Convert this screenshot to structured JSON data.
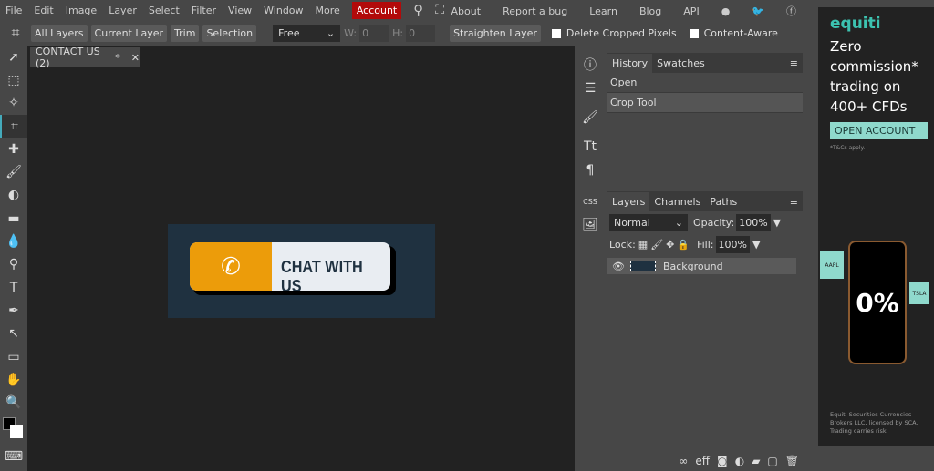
{
  "menu": {
    "items": [
      "File",
      "Edit",
      "Image",
      "Layer",
      "Select",
      "Filter",
      "View",
      "Window",
      "More"
    ],
    "account": "Account",
    "right": [
      "About",
      "Report a bug",
      "Learn",
      "Blog",
      "API"
    ]
  },
  "options": {
    "buttons": [
      "All Layers",
      "Current Layer",
      "Trim",
      "Selection"
    ],
    "ratio": "Free",
    "w_label": "W:",
    "w_value": "0",
    "h_label": "H:",
    "h_value": "0",
    "straighten": "Straighten Layer",
    "delete_cropped": "Delete Cropped Pixels",
    "content_aware": "Content-Aware"
  },
  "document": {
    "tab": "CONTACT US (2)",
    "modified": "*",
    "button_text": "CHAT WITH US"
  },
  "history": {
    "tabs": [
      "History",
      "Swatches"
    ],
    "items": [
      "Open",
      "Crop Tool"
    ]
  },
  "layers": {
    "tabs": [
      "Layers",
      "Channels",
      "Paths"
    ],
    "blend": "Normal",
    "opacity_label": "Opacity:",
    "opacity": "100%",
    "lock_label": "Lock:",
    "fill_label": "Fill:",
    "fill": "100%",
    "layer_name": "Background"
  },
  "ad": {
    "brand": "equiti",
    "headline": "Zero commission* trading on 400+ CFDs",
    "cta": "OPEN ACCOUNT",
    "terms": "*T&Cs apply.",
    "badge": "0%",
    "tickers": [
      "AAPL",
      "TSLA"
    ],
    "legal": "Equiti Securities Currencies Brokers LLC, licensed by SCA. Trading carries risk."
  },
  "colors": {
    "accent": "#b20a0a",
    "orange": "#ec9c0a",
    "canvas_bg": "#1f3140",
    "ad_teal": "#8fd9cc"
  }
}
